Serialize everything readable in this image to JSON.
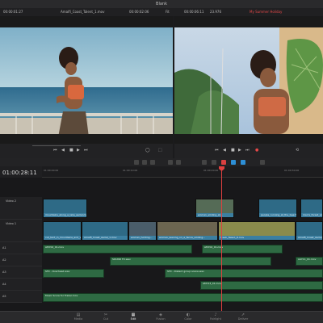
{
  "window": {
    "title": "Blank"
  },
  "infobar": {
    "left_timecode": "00:00:01:27",
    "left_clip": "Amalfi_Coast_Talent_1.mov",
    "left_timecode2": "00:00:02:06",
    "fit": "Fit",
    "right_timecode": "00:00:06:11",
    "zoom": "23.976",
    "right_timeline": "My Summer Holiday"
  },
  "timeline": {
    "timecode": "01:00:28:11",
    "ruler_ticks": [
      "01:00:00:00",
      "01:00:10:00",
      "01:00:20:00",
      "01:00:30:00"
    ],
    "tracks": {
      "video2": "Video 2",
      "video1": "Video 1",
      "a1": "A1",
      "a2": "A2",
      "a3": "A3",
      "a4": "A4",
      "a5": "A5"
    },
    "video_clips": {
      "v2_1": "mountains_along_a_lake_aerial.mp",
      "v2_2": "woman_smiling_at...",
      "v2_3": "people_running_at_the_beach...",
      "v2_4": "man's_forest_view...",
      "v1_1": "cut_tent_in_mountains_and_v...",
      "v1_2": "Amalfi_Coast_Aerial_1.mov",
      "v1_3": "woman_holding...",
      "v1_4": "woman_leaning_on_a_fence_smiling...",
      "v1_5": "Fresh_Talent_8.mov",
      "v1_6": "Amalfi_Coast_Aerial_2.mov"
    },
    "audio_clips": {
      "a1_1": "AMY02_01.mov",
      "a1_2": "AMY02_01.mov",
      "a2_1": "SOUND FX.wav",
      "a2_2": "AAY11_01.mov",
      "a3_1": "SFX - Overhead.wav",
      "a3_2": "SFX - Distant group scene.wav",
      "a4_1": "AMY13_01.mov",
      "a5_1": "Music Score for Trailer.mov"
    }
  },
  "nav": [
    {
      "label": "Media",
      "icon": "media-icon"
    },
    {
      "label": "Cut",
      "icon": "cut-icon"
    },
    {
      "label": "Edit",
      "icon": "edit-icon"
    },
    {
      "label": "Fusion",
      "icon": "fusion-icon"
    },
    {
      "label": "Color",
      "icon": "color-icon"
    },
    {
      "label": "Fairlight",
      "icon": "fairlight-icon"
    },
    {
      "label": "Deliver",
      "icon": "deliver-icon"
    }
  ]
}
